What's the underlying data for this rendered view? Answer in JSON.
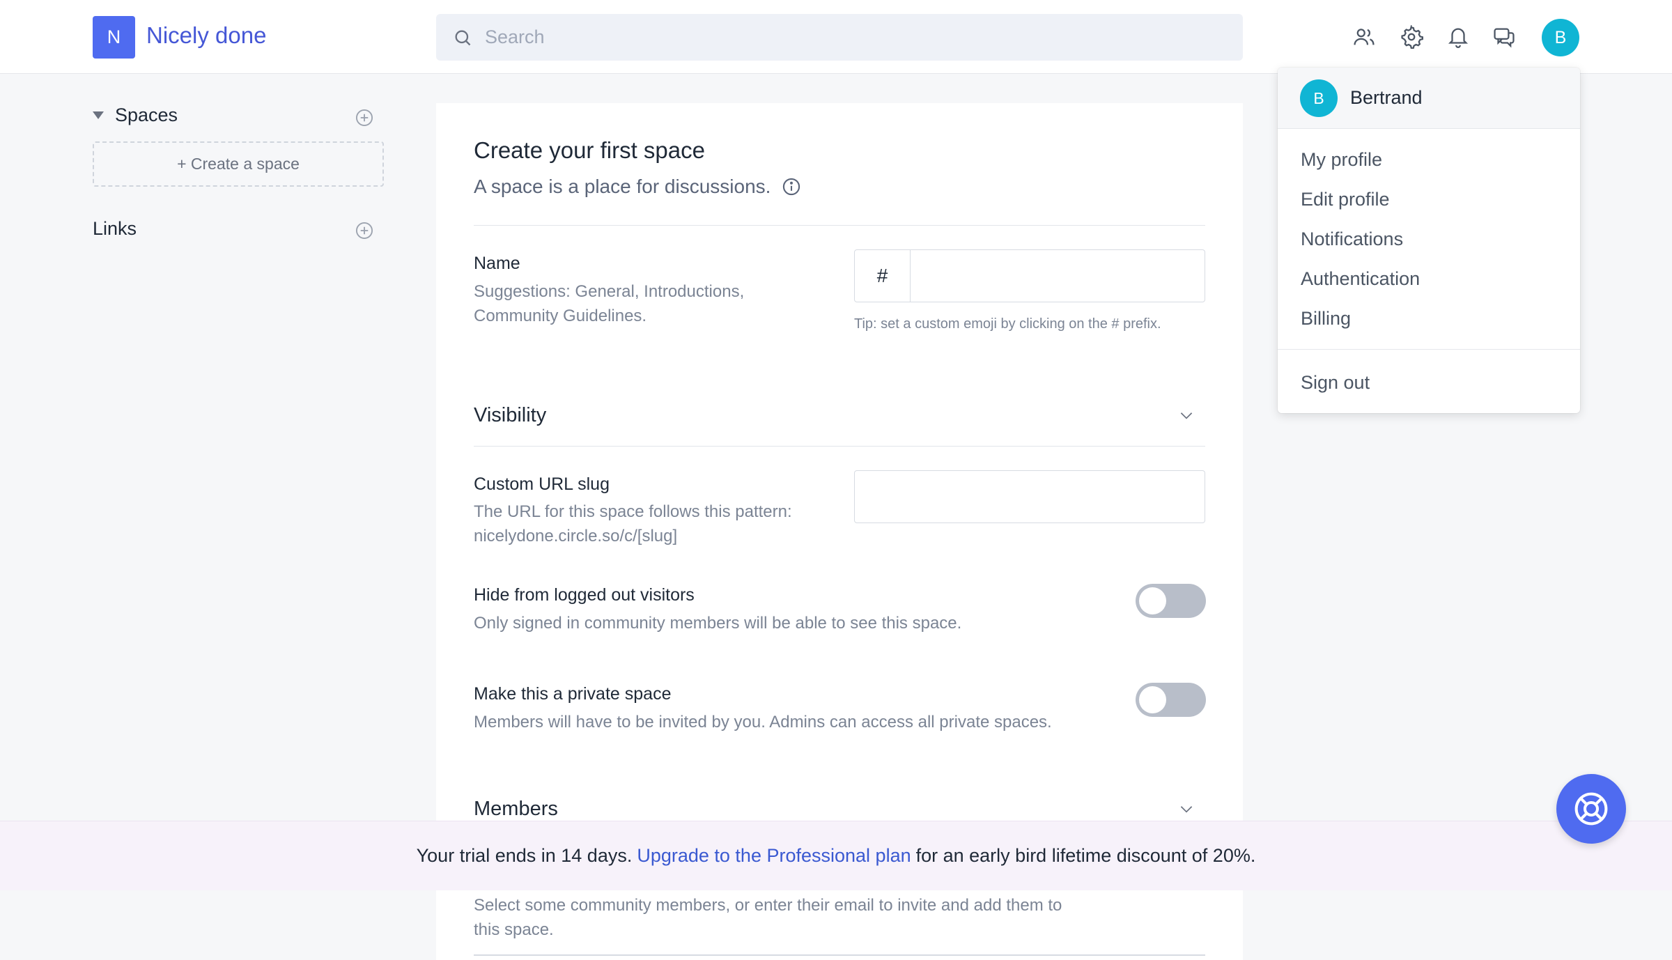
{
  "header": {
    "logo_letter": "N",
    "app_name": "Nicely done",
    "search_placeholder": "Search",
    "avatar_letter": "B",
    "icons": [
      "members-icon",
      "gear-icon",
      "bell-icon",
      "chat-icon"
    ]
  },
  "sidebar": {
    "spaces_label": "Spaces",
    "create_space_label": "+ Create a space",
    "links_label": "Links"
  },
  "main": {
    "title": "Create your first space",
    "subtitle": "A space is a place for discussions.",
    "name": {
      "label": "Name",
      "help_line1": "Suggestions: General, Introductions,",
      "help_line2": "Community Guidelines.",
      "prefix": "#",
      "value": "",
      "tip": "Tip: set a custom emoji by clicking on the # prefix."
    },
    "visibility_title": "Visibility",
    "slug": {
      "label": "Custom URL slug",
      "help_line1": "The URL for this space follows this pattern:",
      "help_line2": "nicelydone.circle.so/c/[slug]",
      "value": ""
    },
    "hide_logged_out": {
      "label": "Hide from logged out visitors",
      "help": "Only signed in community members will be able to see this space.",
      "enabled": false
    },
    "private_space": {
      "label": "Make this a private space",
      "help": "Members will have to be invited by you. Admins can access all private spaces.",
      "enabled": false
    },
    "members_title": "Members",
    "members_help_line1": "Select some community members, or enter their email to invite and add them to",
    "members_help_line2": "this space."
  },
  "banner": {
    "prefix": "Your trial ends in 14 days.",
    "link": "Upgrade to the Professional plan",
    "suffix": "for an early bird lifetime discount of 20%."
  },
  "dropdown": {
    "avatar_letter": "B",
    "user_name": "Bertrand",
    "items": [
      "My profile",
      "Edit profile",
      "Notifications",
      "Authentication",
      "Billing"
    ],
    "sign_out": "Sign out"
  },
  "colors": {
    "brand": "#4f6bf0",
    "avatar": "#10b5d4",
    "link": "#3a59d1"
  }
}
